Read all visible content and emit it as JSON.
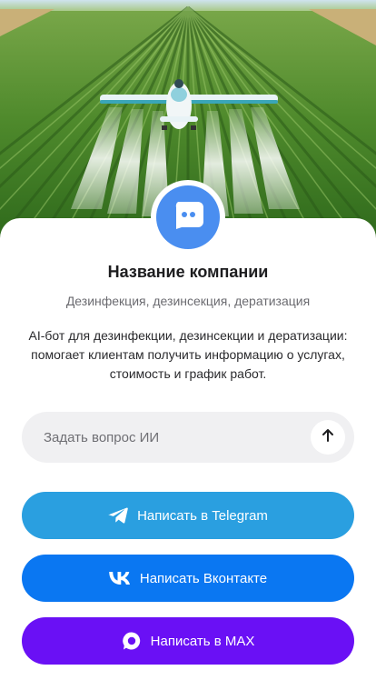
{
  "company": {
    "name": "Название компании",
    "tagline": "Дезинфекция, дезинсекция, дератизация",
    "description": "AI-бот для дезинфекции, дезинсекции и дератизации: помогает клиентам получить информацию о услугах, стоимость и график работ."
  },
  "ask": {
    "placeholder": "Задать вопрос ИИ",
    "value": "",
    "send_icon": "arrow-up-icon"
  },
  "actions": [
    {
      "label": "Написать в Telegram",
      "icon": "telegram-icon",
      "color": "#2a9fe0"
    },
    {
      "label": "Написать Вконтакте",
      "icon": "vk-icon",
      "color": "#0a77f2"
    },
    {
      "label": "Написать в MAX",
      "icon": "max-icon",
      "color": "#6a10f5"
    }
  ],
  "avatar": {
    "icon": "chat-bot-icon",
    "color": "#4a8ef0"
  },
  "hero": {
    "subject": "crop-dusting-plane-over-field-illustration"
  }
}
